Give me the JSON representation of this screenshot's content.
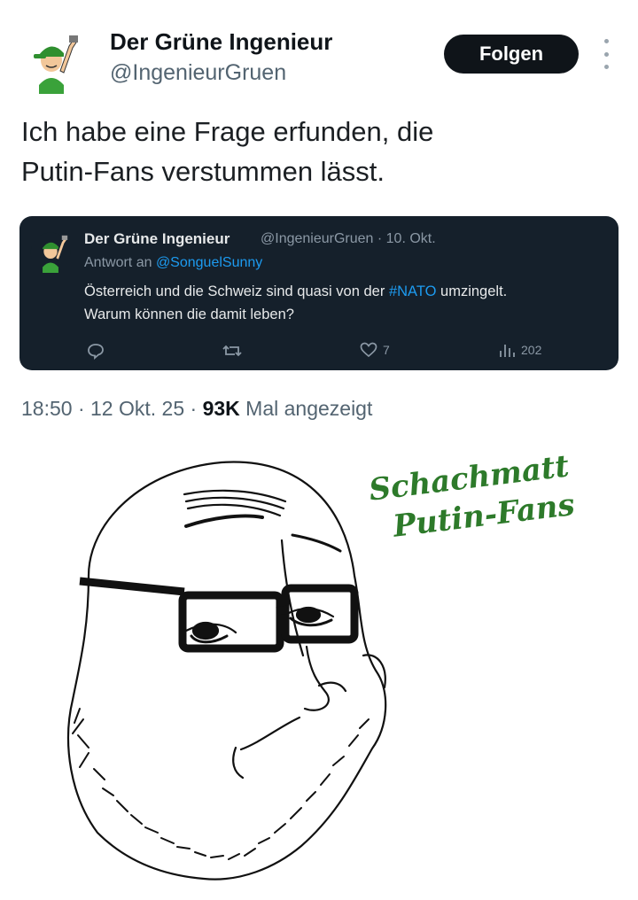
{
  "header": {
    "display_name": "Der Grüne Ingenieur",
    "handle": "@IngenieurGruen",
    "follow_label": "Folgen"
  },
  "tweet": {
    "text_line1": "Ich habe eine Frage erfunden, die",
    "text_line2": "Putin-Fans verstummen lässt."
  },
  "quote": {
    "display_name": "Der Grüne Ingenieur",
    "handle_date": "@IngenieurGruen · 10. Okt.",
    "reply_prefix": "Antwort an",
    "reply_mention": "@SonguelSunny",
    "text_before_tag": "Österreich und die Schweiz sind quasi von der",
    "hashtag": "#NATO",
    "text_after_tag": "umzingelt.",
    "text_line2": "Warum können die damit leben?",
    "likes": "7",
    "views": "202",
    "icons": [
      "reply-icon",
      "retweet-icon",
      "like-icon",
      "views-icon"
    ]
  },
  "meta": {
    "time_date": "18:50 · 12 Okt. 25 ·",
    "views_count": "93K",
    "views_label": "Mal angezeigt"
  },
  "meme": {
    "caption_line1": "Schachmatt",
    "caption_line2": "Putin-Fans",
    "caption_color": "#2d7a2a"
  },
  "colors": {
    "follow_bg": "#0f1419",
    "quote_bg": "#15202b",
    "link": "#1d9bf0",
    "secondary_text": "#536471"
  }
}
